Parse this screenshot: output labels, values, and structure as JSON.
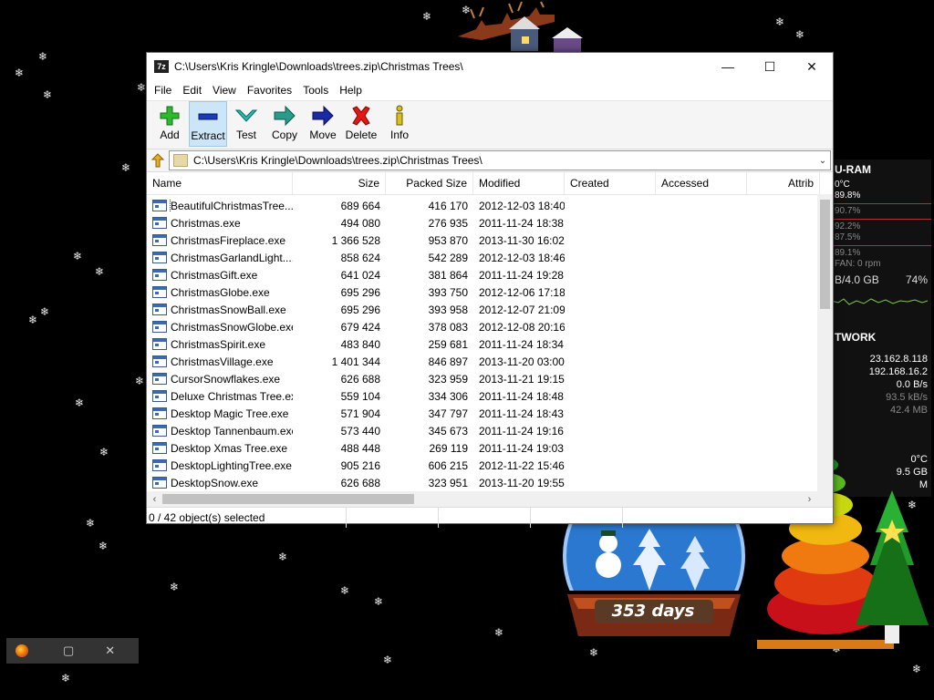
{
  "window": {
    "title": "C:\\Users\\Kris Kringle\\Downloads\\trees.zip\\Christmas Trees\\",
    "app_icon_text": "7z",
    "controls": {
      "minimize": "—",
      "maximize": "☐",
      "close": "✕"
    }
  },
  "menu": [
    "File",
    "Edit",
    "View",
    "Favorites",
    "Tools",
    "Help"
  ],
  "toolbar": [
    {
      "label": "Add",
      "icon": "plus-icon"
    },
    {
      "label": "Extract",
      "icon": "minus-icon"
    },
    {
      "label": "Test",
      "icon": "check-icon"
    },
    {
      "label": "Copy",
      "icon": "arrow-right-icon"
    },
    {
      "label": "Move",
      "icon": "arrow-right-icon"
    },
    {
      "label": "Delete",
      "icon": "x-icon"
    },
    {
      "label": "Info",
      "icon": "info-icon"
    }
  ],
  "address": {
    "path": "C:\\Users\\Kris Kringle\\Downloads\\trees.zip\\Christmas Trees\\"
  },
  "columns": [
    "Name",
    "Size",
    "Packed Size",
    "Modified",
    "Created",
    "Accessed",
    "Attrib"
  ],
  "files": [
    {
      "name": "BeautifulChristmasTree....",
      "size": "689 664",
      "packed": "416 170",
      "modified": "2012-12-03 18:40"
    },
    {
      "name": "Christmas.exe",
      "size": "494 080",
      "packed": "276 935",
      "modified": "2011-11-24 18:38"
    },
    {
      "name": "ChristmasFireplace.exe",
      "size": "1 366 528",
      "packed": "953 870",
      "modified": "2013-11-30 16:02"
    },
    {
      "name": "ChristmasGarlandLight....",
      "size": "858 624",
      "packed": "542 289",
      "modified": "2012-12-03 18:46"
    },
    {
      "name": "ChristmasGift.exe",
      "size": "641 024",
      "packed": "381 864",
      "modified": "2011-11-24 19:28"
    },
    {
      "name": "ChristmasGlobe.exe",
      "size": "695 296",
      "packed": "393 750",
      "modified": "2012-12-06 17:18"
    },
    {
      "name": "ChristmasSnowBall.exe",
      "size": "695 296",
      "packed": "393 958",
      "modified": "2012-12-07 21:09"
    },
    {
      "name": "ChristmasSnowGlobe.exe",
      "size": "679 424",
      "packed": "378 083",
      "modified": "2012-12-08 20:16"
    },
    {
      "name": "ChristmasSpirit.exe",
      "size": "483 840",
      "packed": "259 681",
      "modified": "2011-11-24 18:34"
    },
    {
      "name": "ChristmasVillage.exe",
      "size": "1 401 344",
      "packed": "846 897",
      "modified": "2013-11-20 03:00"
    },
    {
      "name": "CursorSnowflakes.exe",
      "size": "626 688",
      "packed": "323 959",
      "modified": "2013-11-21 19:15"
    },
    {
      "name": "Deluxe Christmas Tree.exe",
      "size": "559 104",
      "packed": "334 306",
      "modified": "2011-11-24 18:48"
    },
    {
      "name": "Desktop Magic Tree.exe",
      "size": "571 904",
      "packed": "347 797",
      "modified": "2011-11-24 18:43"
    },
    {
      "name": "Desktop Tannenbaum.exe",
      "size": "573 440",
      "packed": "345 673",
      "modified": "2011-11-24 19:16"
    },
    {
      "name": "Desktop Xmas Tree.exe",
      "size": "488 448",
      "packed": "269 119",
      "modified": "2011-11-24 19:03"
    },
    {
      "name": "DesktopLightingTree.exe",
      "size": "905 216",
      "packed": "606 215",
      "modified": "2012-11-22 15:46"
    },
    {
      "name": "DesktopSnow.exe",
      "size": "626 688",
      "packed": "323 951",
      "modified": "2013-11-20 19:55"
    }
  ],
  "status": {
    "selected": "0 / 42 object(s) selected"
  },
  "gadget": {
    "header1": "U-RAM",
    "temp1": "0°C",
    "cpu_vals": [
      "89.8%",
      "90.7%",
      "92.2%",
      "87.5%",
      "89.1%"
    ],
    "fan": "FAN: 0 rpm",
    "ram": "B/4.0 GB",
    "ram_pct": "74%",
    "header2": "TWORK",
    "ip1": "23.162.8.118",
    "ip2": "192.168.16.2",
    "rate1": "0.0 B/s",
    "rate2": "93.5 kB/s",
    "rate3": "42.4 MB",
    "temp2": "0°C",
    "disk": "9.5 GB",
    "disk2": "M"
  },
  "countdown": {
    "value": "353 days"
  },
  "taskbar_thumb": {
    "restore": "▢",
    "close": "✕"
  }
}
